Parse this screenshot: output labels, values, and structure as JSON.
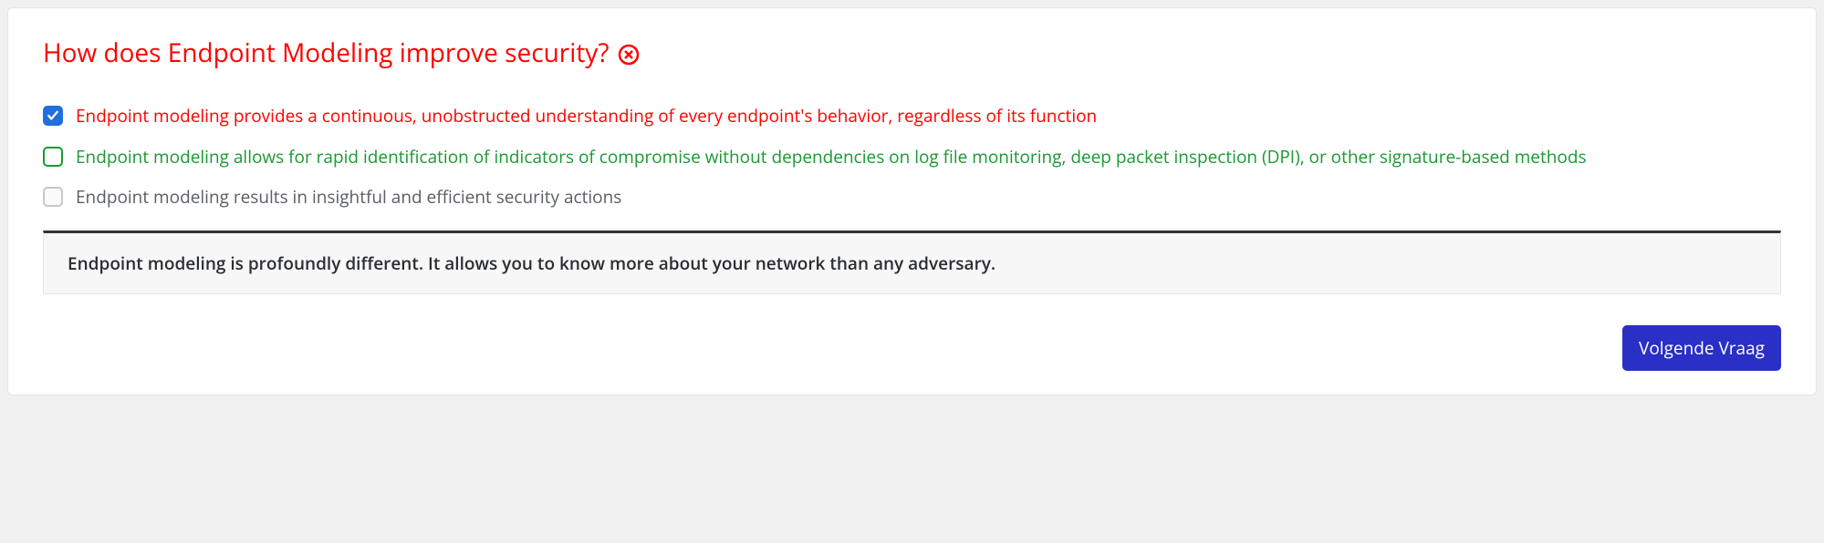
{
  "question": "How does Endpoint Modeling improve security?",
  "answers": [
    {
      "text": "Endpoint modeling provides a continuous, unobstructed understanding of every endpoint's behavior, regardless of its function",
      "status": "wrong",
      "checked": true
    },
    {
      "text": "Endpoint modeling allows for rapid identification of indicators of compromise without dependencies on log file monitoring, deep packet inspection (DPI), or other signature-based methods",
      "status": "correct",
      "checked": false
    },
    {
      "text": "Endpoint modeling results in insightful and efficient security actions",
      "status": "neutral",
      "checked": false
    }
  ],
  "explanation": "Endpoint modeling is profoundly different. It allows you to know more about your network than any adversary.",
  "next_button_label": "Volgende Vraag"
}
